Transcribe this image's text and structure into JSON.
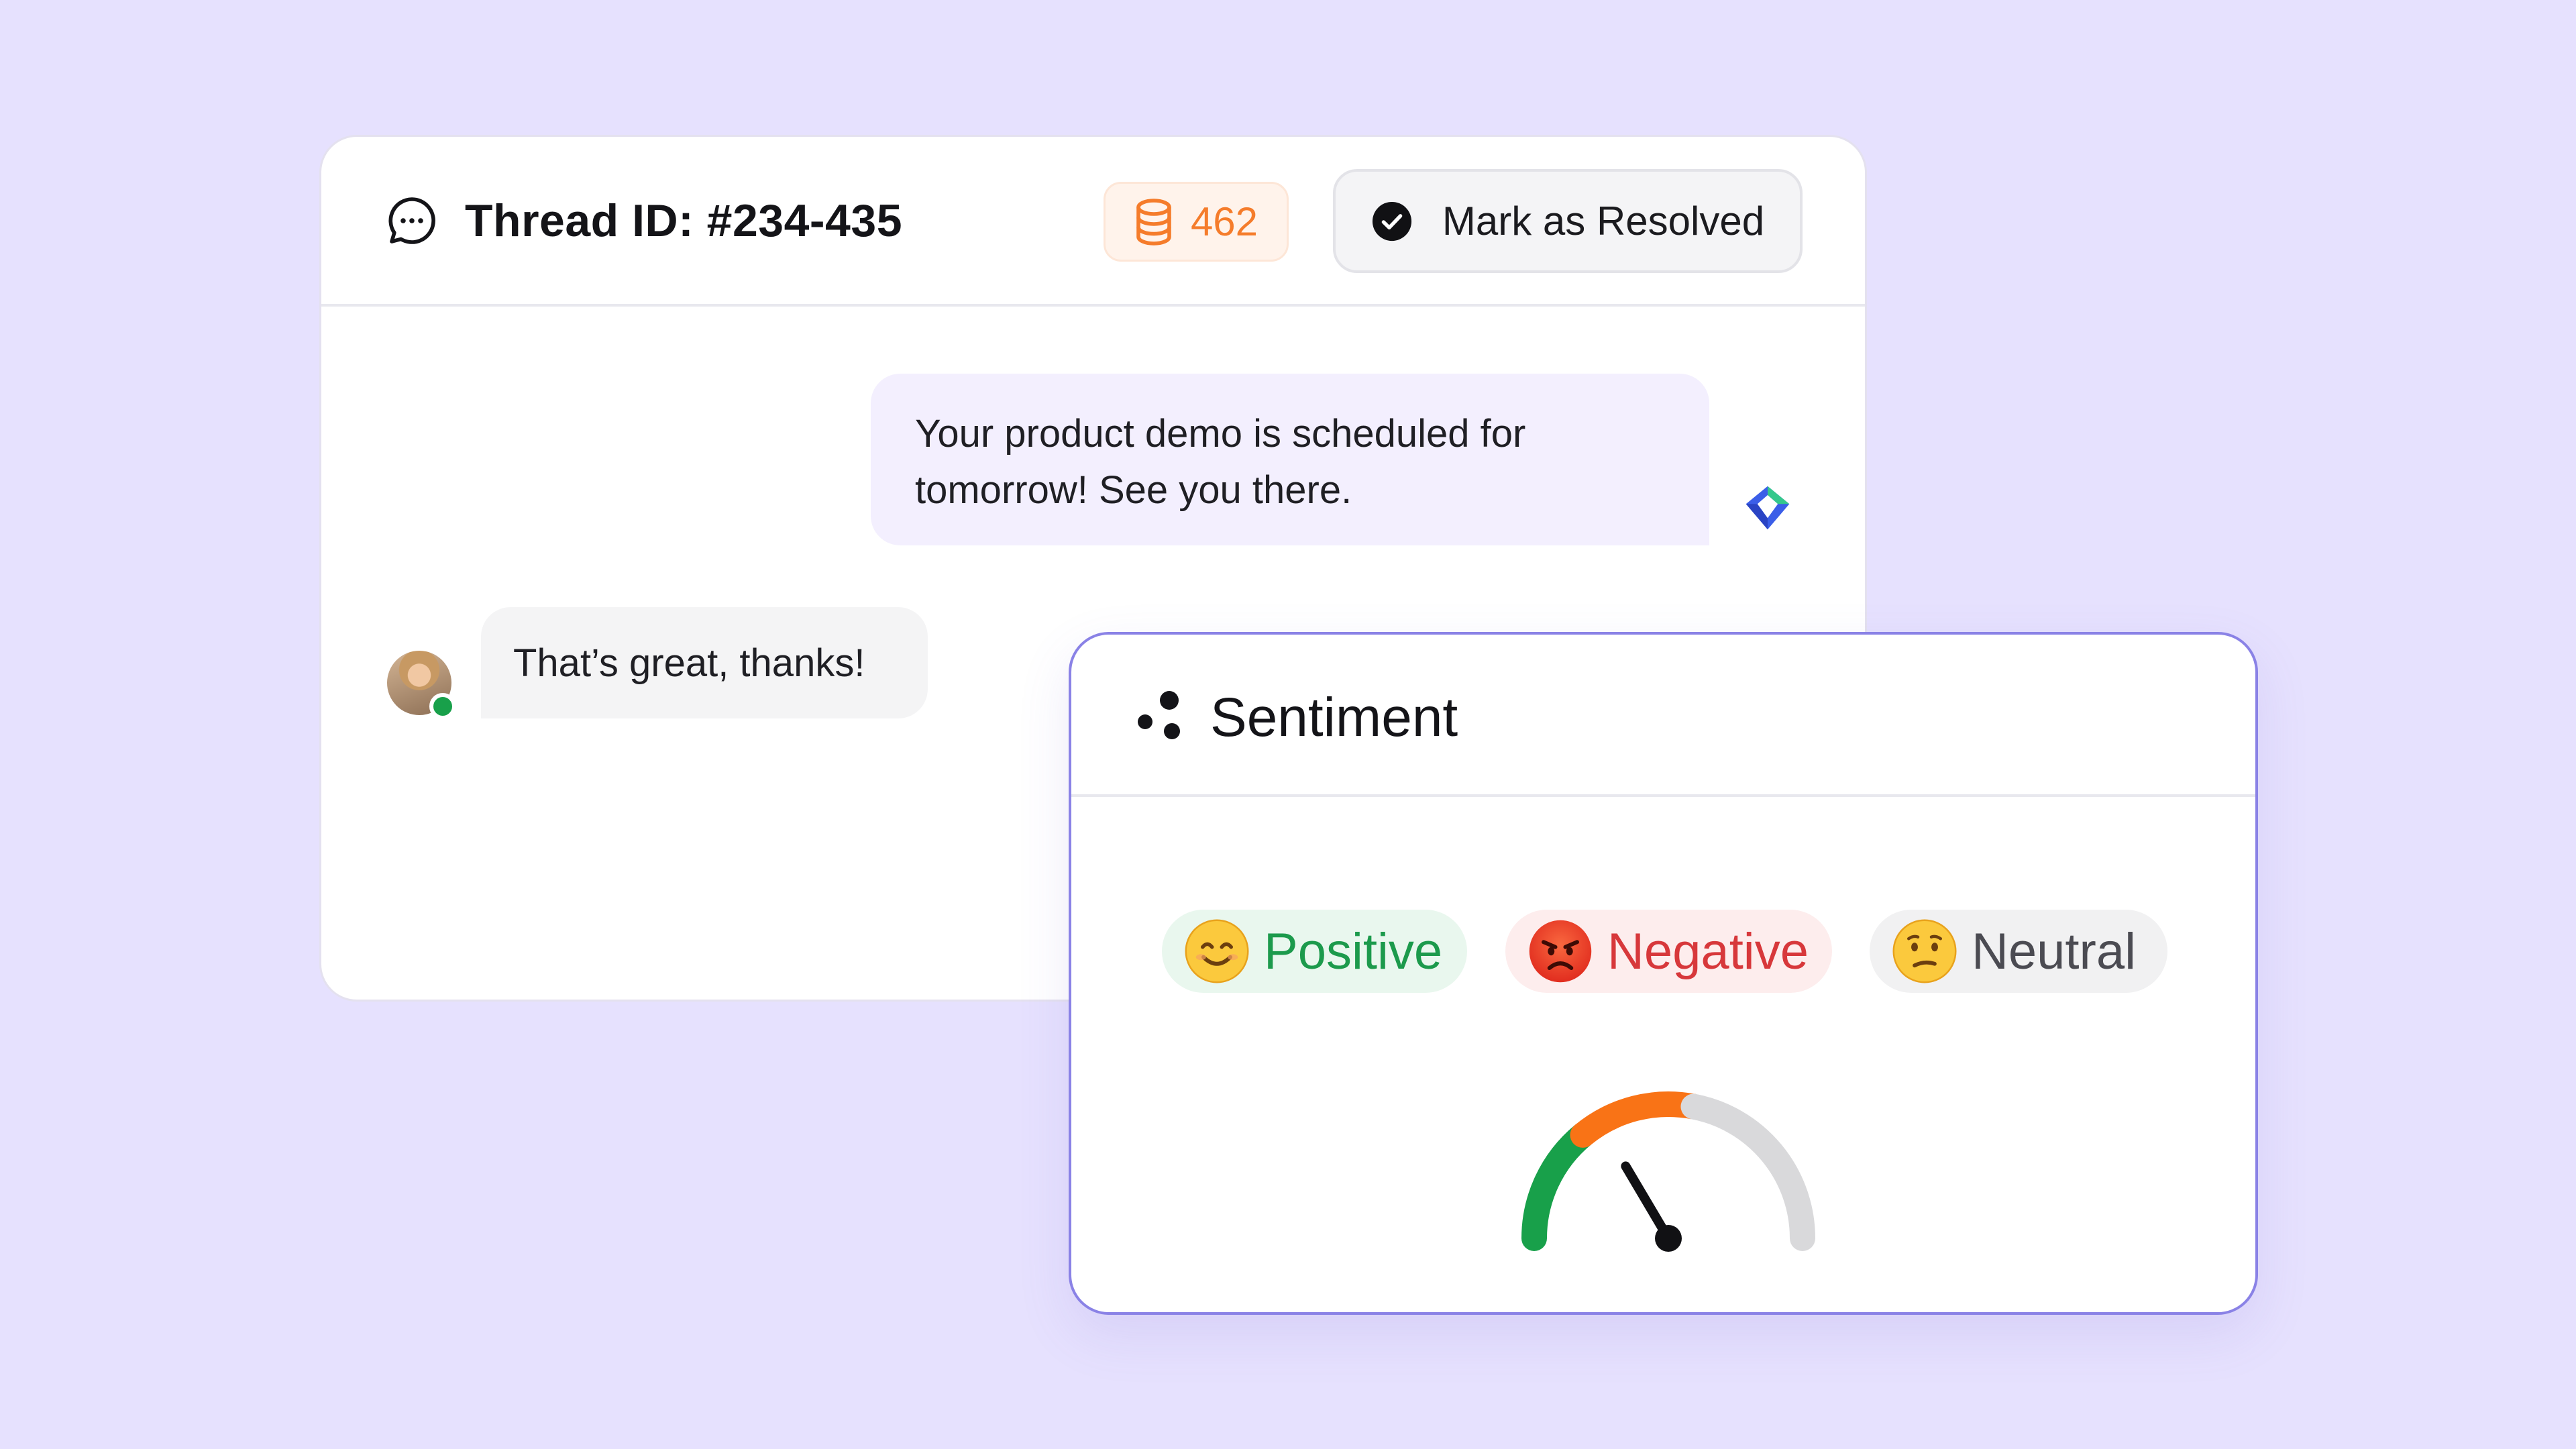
{
  "thread": {
    "title": "Thread ID: #234-435",
    "credits": "462",
    "resolve_label": "Mark as Resolved",
    "icons": {
      "thread": "chat-bubble-dots-icon",
      "credits": "coin-stack-icon",
      "resolve": "check-circle-icon",
      "brand": "brand-logo-icon"
    },
    "messages": [
      {
        "direction": "outgoing",
        "text": "Your product demo is scheduled for tomorrow! See you there."
      },
      {
        "direction": "incoming",
        "text": "That’s great, thanks!",
        "status": "online"
      }
    ]
  },
  "sentiment": {
    "title": "Sentiment",
    "icon": "dots-icon",
    "options": [
      {
        "label": "Positive",
        "emoji": "smiling-face-icon",
        "color": "#1c9a4c"
      },
      {
        "label": "Negative",
        "emoji": "angry-face-icon",
        "color": "#d7383b"
      },
      {
        "label": "Neutral",
        "emoji": "confused-face-icon",
        "color": "#4b4b52"
      }
    ],
    "gauge": {
      "segments": [
        {
          "name": "positive",
          "color": "#18a04a",
          "fraction": 0.28
        },
        {
          "name": "negative",
          "color": "#f97316",
          "fraction": 0.28
        },
        {
          "name": "neutral",
          "color": "#d9d9db",
          "fraction": 0.44
        }
      ],
      "needle_value": 0.33
    }
  },
  "colors": {
    "background": "#e6e1fe",
    "accent_border": "#8a82e6",
    "credits_orange": "#f57c2b"
  }
}
